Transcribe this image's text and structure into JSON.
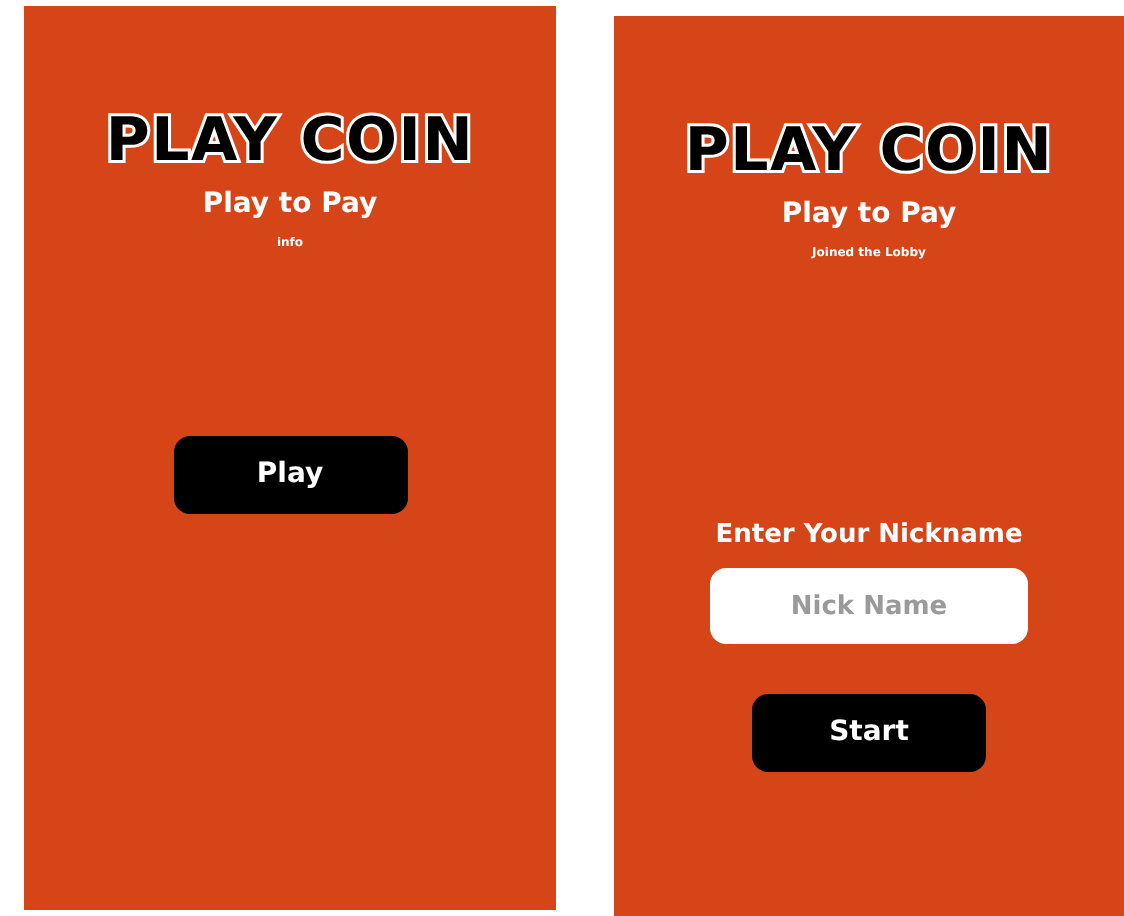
{
  "screens": [
    {
      "title": "PLAY COIN",
      "subtitle": "Play to Pay",
      "status": "info",
      "button": "Play"
    },
    {
      "title": "PLAY COIN",
      "subtitle": "Play to Pay",
      "status": "Joined the Lobby",
      "prompt": "Enter Your Nickname",
      "nickname": {
        "placeholder": "Nick Name"
      },
      "button": "Start"
    }
  ]
}
